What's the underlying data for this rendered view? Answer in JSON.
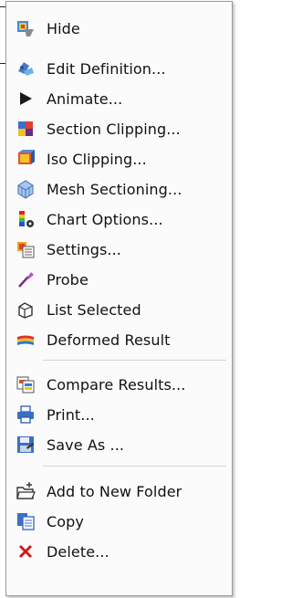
{
  "menu": {
    "items": [
      {
        "id": "hide",
        "label": "Hide",
        "icon": "hide-icon"
      },
      {
        "id": "edit-definition",
        "label": "Edit Definition...",
        "icon": "edit-definition-icon"
      },
      {
        "id": "animate",
        "label": "Animate...",
        "icon": "play-arrow-icon"
      },
      {
        "id": "section-clipping",
        "label": "Section Clipping...",
        "icon": "section-clipping-icon"
      },
      {
        "id": "iso-clipping",
        "label": "Iso Clipping...",
        "icon": "iso-clipping-icon"
      },
      {
        "id": "mesh-sectioning",
        "label": "Mesh Sectioning...",
        "icon": "mesh-sectioning-icon"
      },
      {
        "id": "chart-options",
        "label": "Chart Options...",
        "icon": "chart-options-icon"
      },
      {
        "id": "settings",
        "label": "Settings...",
        "icon": "settings-icon"
      },
      {
        "id": "probe",
        "label": "Probe",
        "icon": "probe-icon"
      },
      {
        "id": "list-selected",
        "label": "List Selected",
        "icon": "list-selected-icon"
      },
      {
        "id": "deformed-result",
        "label": "Deformed Result",
        "icon": "deformed-result-icon"
      },
      {
        "id": "compare-results",
        "label": "Compare Results...",
        "icon": "compare-results-icon"
      },
      {
        "id": "print",
        "label": "Print...",
        "icon": "printer-icon"
      },
      {
        "id": "save-as",
        "label": "Save As ...",
        "icon": "save-as-icon"
      },
      {
        "id": "add-to-new-folder",
        "label": "Add to New Folder",
        "icon": "folder-icon"
      },
      {
        "id": "copy",
        "label": "Copy",
        "icon": "copy-icon"
      },
      {
        "id": "delete",
        "label": "Delete...",
        "icon": "delete-x-icon"
      }
    ]
  },
  "colors": {
    "delete_red": "#d11919",
    "separator": "#d4d4d4"
  }
}
